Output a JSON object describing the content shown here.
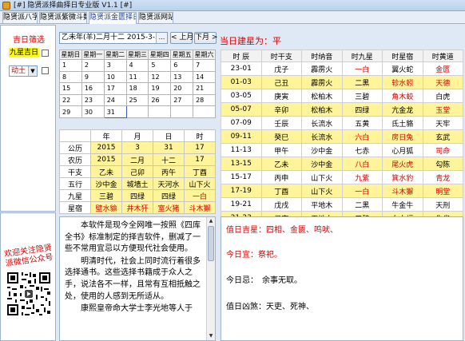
{
  "window": {
    "title": "[#] 隐贤派择曲择日专业版 V1.1 [#]"
  },
  "tabs": [
    {
      "label": "隐贤派八字",
      "active": false
    },
    {
      "label": "隐贤派紫微斗数",
      "active": false
    },
    {
      "label": "隐贤派金匮择日",
      "active": true
    },
    {
      "label": "隐贤派网站",
      "active": false
    }
  ],
  "filter": {
    "title": "吉日筛选",
    "jiuxing_label": "九星吉日",
    "jiuxing_checked": false,
    "dongtu_value": "动土",
    "dongtu_checked": false
  },
  "promo": {
    "text": "欢迎关注隐贤派微信公众号"
  },
  "date_bar": {
    "date_value": "乙未年(羊)二月十二  2015-3-31",
    "browse_label": "...",
    "prev_label": "< 上月",
    "next_label": "下月 >",
    "jianxing_text": "当日建星为：平"
  },
  "calendar": {
    "headers": [
      "星期日",
      "星期一",
      "星期二",
      "星期三",
      "星期四",
      "星期五",
      "星期六"
    ],
    "rows": [
      [
        "1",
        "2",
        "3",
        "4",
        "5",
        "6",
        "7"
      ],
      [
        "8",
        "9",
        "10",
        "11",
        "12",
        "13",
        "14"
      ],
      [
        "15",
        "16",
        "17",
        "18",
        "19",
        "20",
        "21"
      ],
      [
        "22",
        "23",
        "24",
        "25",
        "26",
        "27",
        "28"
      ],
      [
        "29",
        "30",
        "31",
        "",
        "",
        "",
        ""
      ]
    ],
    "selected_day": "31"
  },
  "info_grid": {
    "headers": [
      "",
      "年",
      "月",
      "日",
      "时"
    ],
    "rows": [
      {
        "label": "公历",
        "cells": [
          "2015",
          "3",
          "31",
          "17"
        ]
      },
      {
        "label": "农历",
        "cells": [
          "2015",
          "二月",
          "十二",
          "17"
        ]
      },
      {
        "label": "干支",
        "cells": [
          "乙未",
          "己卯",
          "丙午",
          "丁酉"
        ]
      },
      {
        "label": "五行",
        "cells": [
          "沙中金",
          "城墙土",
          "天河水",
          "山下火"
        ]
      },
      {
        "label": "九星",
        "cells": [
          "三碧",
          "四绿",
          "四绿",
          "一白"
        ]
      },
      {
        "label": "星宿",
        "cells": [
          "壁水貐",
          "井木犴",
          "室火猪",
          "斗木獬"
        ]
      }
    ]
  },
  "hours_table": {
    "headers": [
      "时 辰",
      "时干支",
      "时纳音",
      "时九星",
      "时星宿",
      "时黄道"
    ],
    "rows": [
      [
        "23-01",
        "戊子",
        "霹雳火",
        "一白",
        "翼火蛇",
        "金匮"
      ],
      [
        "01-03",
        "己丑",
        "霹雳火",
        "二黑",
        "轸水蚓",
        "天德"
      ],
      [
        "03-05",
        "庚寅",
        "松柏木",
        "三碧",
        "角木蛟",
        "白虎"
      ],
      [
        "05-07",
        "辛卯",
        "松柏木",
        "四绿",
        "亢金龙",
        "玉堂"
      ],
      [
        "07-09",
        "壬辰",
        "长流水",
        "五黄",
        "氐土貉",
        "天牢"
      ],
      [
        "09-11",
        "癸巳",
        "长流水",
        "六白",
        "房日兔",
        "玄武"
      ],
      [
        "11-13",
        "甲午",
        "沙中金",
        "七赤",
        "心月狐",
        "司命"
      ],
      [
        "13-15",
        "乙未",
        "沙中金",
        "八白",
        "尾火虎",
        "勾陈"
      ],
      [
        "15-17",
        "丙申",
        "山下火",
        "九紫",
        "箕水豹",
        "青龙"
      ],
      [
        "17-19",
        "丁酉",
        "山下火",
        "一白",
        "斗木獬",
        "明堂"
      ],
      [
        "19-21",
        "戊戌",
        "平地木",
        "二黑",
        "牛金牛",
        "天刑"
      ],
      [
        "21-23",
        "己亥",
        "平地木",
        "三碧",
        "女土蝠",
        "朱雀"
      ]
    ]
  },
  "description": {
    "paragraphs": [
      "本软件是现今全网唯一按照《四库全书》标准制定的择吉软件，删减了一些不常用宜忌以方便现代社会使用。",
      "明清时代，社会上同时流行着很多选择通书。这些选择书籍成于众人之手，说法各不一样，且常有互相抵触之处，使用的人感到无所适从。",
      "康熙皇帝命大学士李光地等人于"
    ]
  },
  "result": {
    "jishen": "值日吉星：四相、金匮、鸣吠、",
    "jin_yi": "今日宜：祭祀。",
    "jin_ji": "今日忌：　余事无取。",
    "xiongsha": "值日凶煞：天吏、死神、"
  },
  "colors": {
    "red_text": "#d40000",
    "highlight_yellow": "#fff49a",
    "window_bg": "#dfe8f5"
  }
}
